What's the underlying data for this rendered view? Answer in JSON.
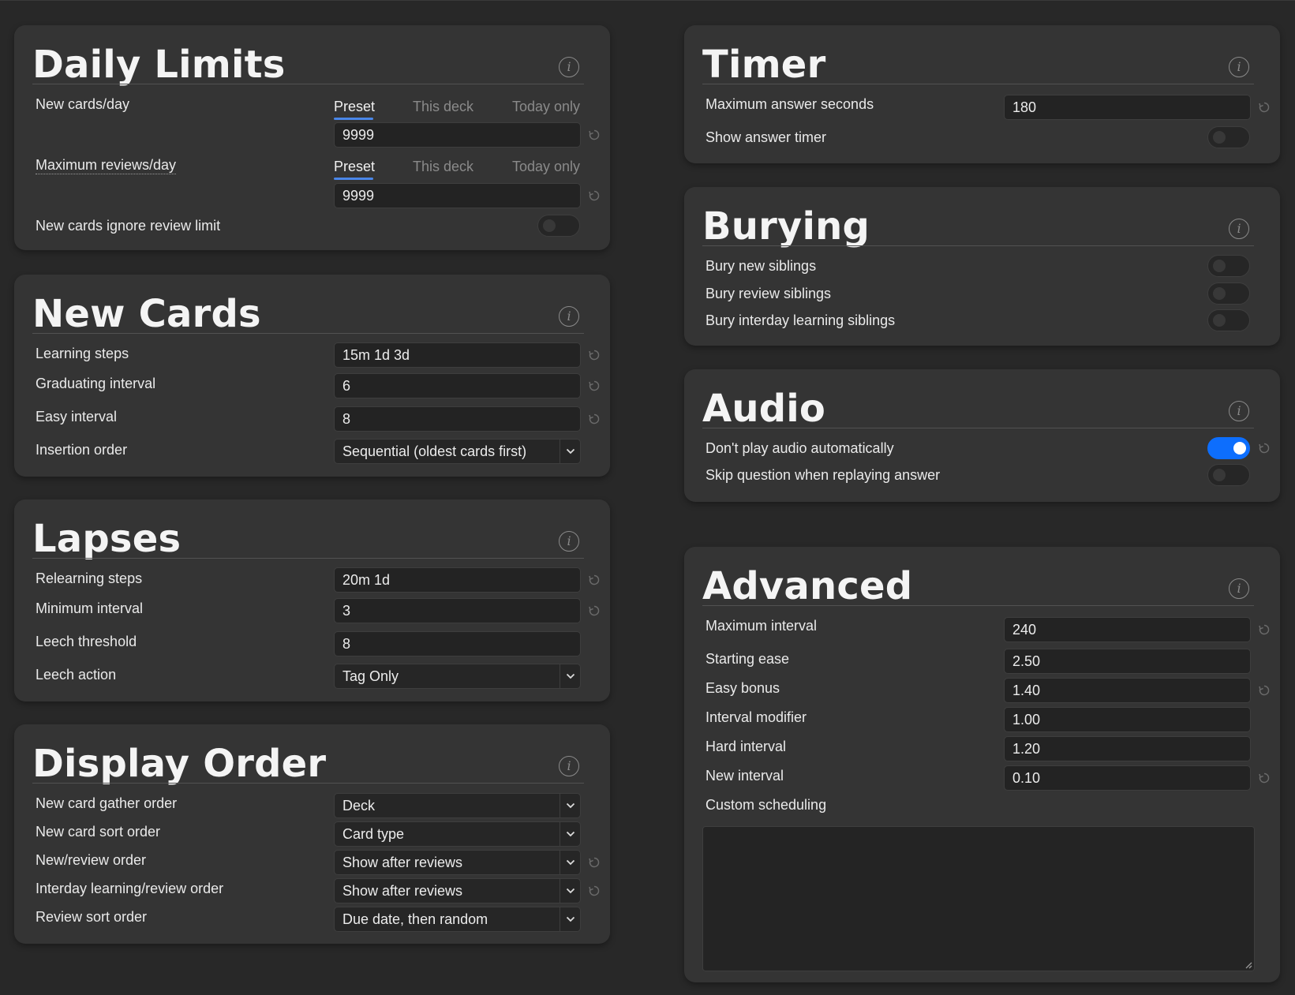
{
  "colors": {
    "background": "#282828",
    "card": "#343434",
    "accent": "#4a86e8",
    "toggle_on": "#0d6efd"
  },
  "icons": {
    "info": "info-circle-icon",
    "revert": "revert-arrow-icon",
    "caret": "chevron-down-icon",
    "resize": "resize-grip-icon"
  },
  "info_glyph": "i",
  "daily_limits": {
    "title": "Daily Limits",
    "new_cards_label": "New cards/day",
    "max_reviews_label": "Maximum reviews/day",
    "tabs": [
      "Preset",
      "This deck",
      "Today only"
    ],
    "active_tab": "Preset",
    "new_cards_value": "9999",
    "max_reviews_value": "9999",
    "ignore_limit_label": "New cards ignore review limit",
    "ignore_limit_on": false
  },
  "new_cards": {
    "title": "New Cards",
    "learning_steps_label": "Learning steps",
    "learning_steps_value": "15m 1d 3d",
    "graduating_interval_label": "Graduating interval",
    "graduating_interval_value": "6",
    "easy_interval_label": "Easy interval",
    "easy_interval_value": "8",
    "insertion_order_label": "Insertion order",
    "insertion_order_value": "Sequential (oldest cards first)"
  },
  "lapses": {
    "title": "Lapses",
    "relearning_steps_label": "Relearning steps",
    "relearning_steps_value": "20m 1d",
    "minimum_interval_label": "Minimum interval",
    "minimum_interval_value": "3",
    "leech_threshold_label": "Leech threshold",
    "leech_threshold_value": "8",
    "leech_action_label": "Leech action",
    "leech_action_value": "Tag Only"
  },
  "display_order": {
    "title": "Display Order",
    "gather_label": "New card gather order",
    "gather_value": "Deck",
    "sort_label": "New card sort order",
    "sort_value": "Card type",
    "new_review_label": "New/review order",
    "new_review_value": "Show after reviews",
    "interday_label": "Interday learning/review order",
    "interday_value": "Show after reviews",
    "review_sort_label": "Review sort order",
    "review_sort_value": "Due date, then random"
  },
  "timer": {
    "title": "Timer",
    "max_answer_label": "Maximum answer seconds",
    "max_answer_value": "180",
    "show_timer_label": "Show answer timer",
    "show_timer_on": false
  },
  "burying": {
    "title": "Burying",
    "new_siblings_label": "Bury new siblings",
    "review_siblings_label": "Bury review siblings",
    "interday_siblings_label": "Bury interday learning siblings"
  },
  "audio": {
    "title": "Audio",
    "dont_play_label": "Don't play audio automatically",
    "dont_play_on": true,
    "skip_question_label": "Skip question when replaying answer",
    "skip_question_on": false
  },
  "advanced": {
    "title": "Advanced",
    "maximum_interval_label": "Maximum interval",
    "maximum_interval_value": "240",
    "starting_ease_label": "Starting ease",
    "starting_ease_value": "2.50",
    "easy_bonus_label": "Easy bonus",
    "easy_bonus_value": "1.40",
    "interval_modifier_label": "Interval modifier",
    "interval_modifier_value": "1.00",
    "hard_interval_label": "Hard interval",
    "hard_interval_value": "1.20",
    "new_interval_label": "New interval",
    "new_interval_value": "0.10",
    "custom_scheduling_label": "Custom scheduling",
    "custom_scheduling_value": ""
  }
}
